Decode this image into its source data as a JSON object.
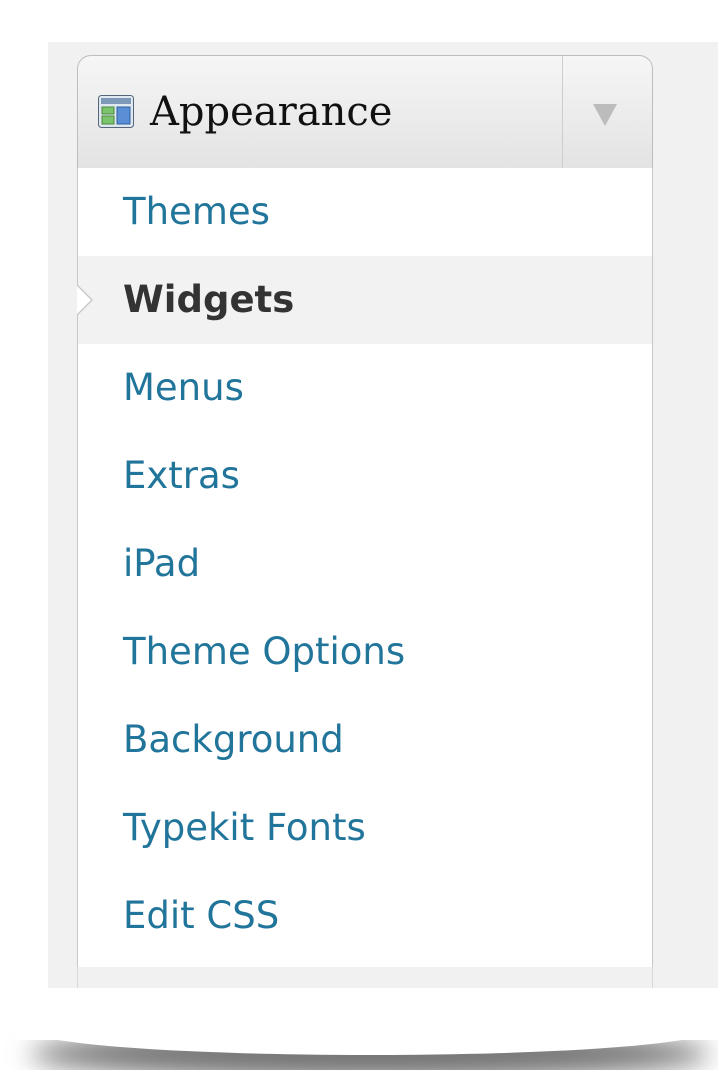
{
  "menu": {
    "title": "Appearance",
    "icon": "appearance-icon",
    "toggle_icon": "chevron-down-icon",
    "items": [
      {
        "label": "Themes",
        "current": false
      },
      {
        "label": "Widgets",
        "current": true
      },
      {
        "label": "Menus",
        "current": false
      },
      {
        "label": "Extras",
        "current": false
      },
      {
        "label": "iPad",
        "current": false
      },
      {
        "label": "Theme Options",
        "current": false
      },
      {
        "label": "Background",
        "current": false
      },
      {
        "label": "Typekit Fonts",
        "current": false
      },
      {
        "label": "Edit CSS",
        "current": false
      }
    ]
  },
  "colors": {
    "link": "#21759b",
    "current_text": "#333333",
    "current_bg": "#f2f2f2",
    "header_gradient_top": "#f6f6f6",
    "header_gradient_bottom": "#e3e3e3"
  }
}
